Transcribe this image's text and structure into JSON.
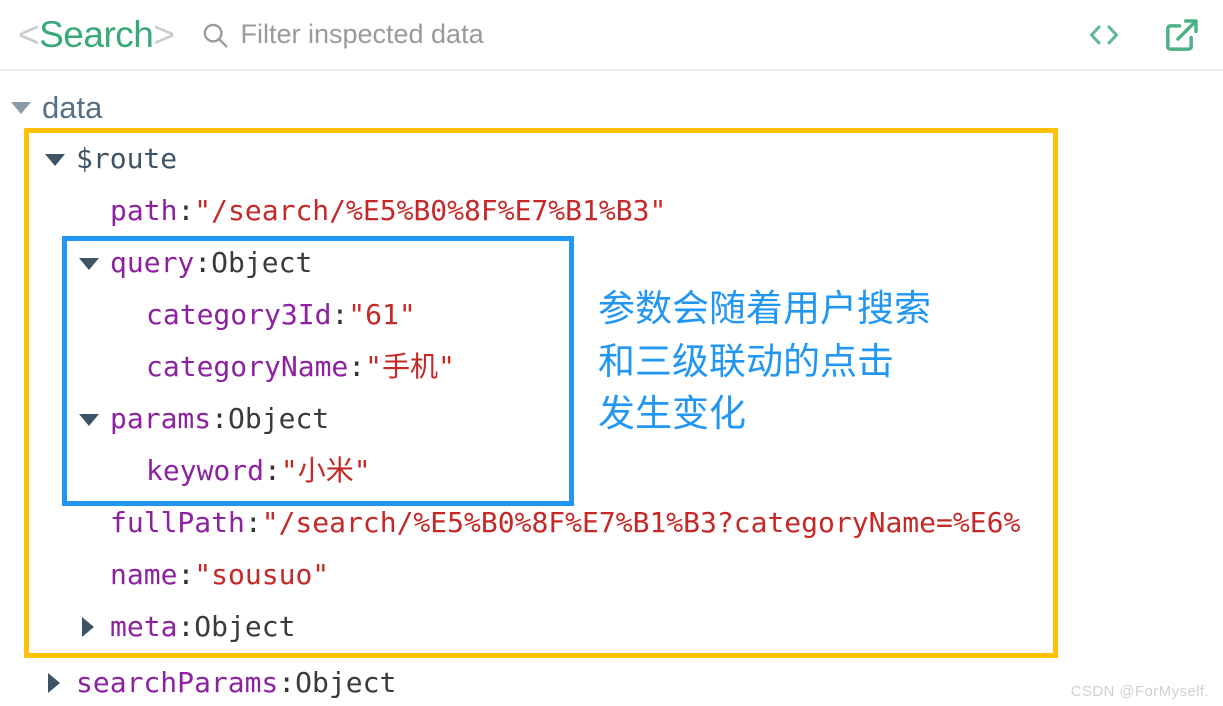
{
  "toolbar": {
    "component_bracket_open": "<",
    "component_name": "Search",
    "component_bracket_close": ">",
    "search_icon": "search-icon",
    "filter_value": "",
    "filter_placeholder": "Filter inspected data",
    "code_button_label": "<>",
    "open_external_icon": "external-link-icon",
    "accent_green": "#3aa97a",
    "bracket_gray": "#c9cdd0"
  },
  "tree": {
    "root": {
      "label": "data",
      "expanded": true
    },
    "rows": [
      {
        "id": "route",
        "caret": "open",
        "label": "$route",
        "key": "",
        "value": "",
        "indent": 1
      },
      {
        "id": "path",
        "caret": "none",
        "key": "path",
        "sep": ": ",
        "value": "\"/search/%E5%B0%8F%E7%B1%B3\"",
        "kind": "string",
        "indent": 2
      },
      {
        "id": "query",
        "caret": "open",
        "key": "query",
        "sep": ": ",
        "value": "Object",
        "kind": "type",
        "indent": 2
      },
      {
        "id": "category3Id",
        "caret": "none",
        "key": "category3Id",
        "sep": ": ",
        "value": "\"61\"",
        "kind": "string",
        "indent": 3
      },
      {
        "id": "categoryName",
        "caret": "none",
        "key": "categoryName",
        "sep": ": ",
        "value": "\"手机\"",
        "kind": "string",
        "indent": 3
      },
      {
        "id": "params",
        "caret": "open",
        "key": "params",
        "sep": ": ",
        "value": "Object",
        "kind": "type",
        "indent": 2
      },
      {
        "id": "keyword",
        "caret": "none",
        "key": "keyword",
        "sep": ": ",
        "value": "\"小米\"",
        "kind": "string",
        "indent": 3
      },
      {
        "id": "fullPath",
        "caret": "none",
        "key": "fullPath",
        "sep": ": ",
        "value": "\"/search/%E5%B0%8F%E7%B1%B3?categoryName=%E6%",
        "kind": "string",
        "indent": 2
      },
      {
        "id": "name",
        "caret": "none",
        "key": "name",
        "sep": ": ",
        "value": "\"sousuo\"",
        "kind": "string",
        "indent": 2
      },
      {
        "id": "meta",
        "caret": "closed",
        "key": "meta",
        "sep": ": ",
        "value": "Object",
        "kind": "type",
        "indent": 2
      },
      {
        "id": "searchParams",
        "caret": "closed",
        "key": "searchParams",
        "sep": ": ",
        "value": "Object",
        "kind": "type",
        "indent": 1
      }
    ]
  },
  "annotation": {
    "text": "参数会随着用户搜索\n和三级联动的点击\n发生变化",
    "color": "#2196F3"
  },
  "highlight_boxes": {
    "route_box_color": "#FFC107",
    "query_box_color": "#2196F3"
  },
  "watermark": {
    "text": "CSDN @ForMyself."
  }
}
